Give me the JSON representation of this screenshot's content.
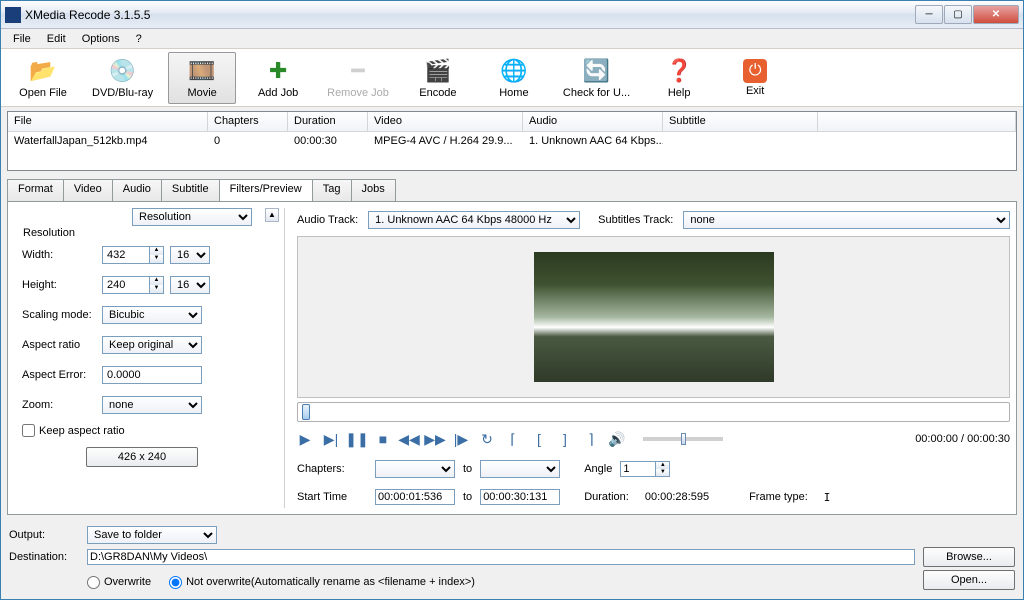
{
  "window": {
    "title": "XMedia Recode 3.1.5.5"
  },
  "menu": {
    "file": "File",
    "edit": "Edit",
    "options": "Options",
    "help": "?"
  },
  "toolbar": {
    "open_file": "Open File",
    "dvd": "DVD/Blu-ray",
    "movie": "Movie",
    "add_job": "Add Job",
    "remove_job": "Remove Job",
    "encode": "Encode",
    "home": "Home",
    "check_update": "Check for U...",
    "help": "Help",
    "exit": "Exit"
  },
  "filelist": {
    "headers": {
      "file": "File",
      "chapters": "Chapters",
      "duration": "Duration",
      "video": "Video",
      "audio": "Audio",
      "subtitle": "Subtitle"
    },
    "rows": [
      {
        "file": "WaterfallJapan_512kb.mp4",
        "chapters": "0",
        "duration": "00:00:30",
        "video": "MPEG-4 AVC / H.264 29.9...",
        "audio": "1. Unknown AAC  64 Kbps...",
        "subtitle": ""
      }
    ]
  },
  "tabs": {
    "format": "Format",
    "video": "Video",
    "audio": "Audio",
    "subtitle": "Subtitle",
    "filters": "Filters/Preview",
    "tag": "Tag",
    "jobs": "Jobs"
  },
  "filters": {
    "effect_dropdown": "Resolution",
    "legend": "Resolution",
    "width_label": "Width:",
    "width_value": "432",
    "width_step": "16",
    "height_label": "Height:",
    "height_value": "240",
    "height_step": "16",
    "scaling_label": "Scaling mode:",
    "scaling_value": "Bicubic",
    "aspect_label": "Aspect ratio",
    "aspect_value": "Keep original",
    "aspect_err_label": "Aspect Error:",
    "aspect_err_value": "0.0000",
    "zoom_label": "Zoom:",
    "zoom_value": "none",
    "keep_aspect": "Keep aspect ratio",
    "res_button": "426 x 240"
  },
  "tracks": {
    "audio_label": "Audio Track:",
    "audio_value": "1. Unknown AAC  64 Kbps 48000 Hz",
    "sub_label": "Subtitles Track:",
    "sub_value": "none"
  },
  "playback": {
    "time": "00:00:00 / 00:00:30",
    "chapters_label": "Chapters:",
    "to": "to",
    "angle_label": "Angle",
    "angle_value": "1",
    "start_label": "Start Time",
    "start_value": "00:00:01:536",
    "end_value": "00:00:30:131",
    "duration_label": "Duration:",
    "duration_value": "00:00:28:595",
    "frame_type_label": "Frame type:",
    "frame_type_value": "I"
  },
  "output": {
    "output_label": "Output:",
    "output_value": "Save to folder",
    "dest_label": "Destination:",
    "dest_value": "D:\\GR8DAN\\My Videos\\",
    "browse": "Browse...",
    "open": "Open...",
    "overwrite": "Overwrite",
    "not_overwrite": "Not overwrite(Automatically rename as <filename + index>)"
  }
}
